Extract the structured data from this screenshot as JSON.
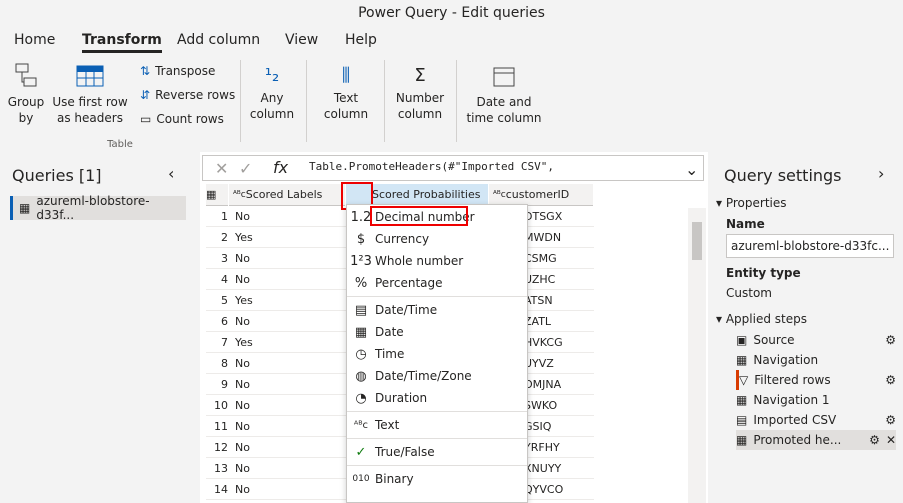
{
  "window": {
    "title": "Power Query - Edit queries"
  },
  "tabs": [
    "Home",
    "Transform",
    "Add column",
    "View",
    "Help"
  ],
  "ribbon": {
    "group_by": "Group by",
    "first_row": "Use first row as headers",
    "transpose": "Transpose",
    "reverse_rows": "Reverse rows",
    "count_rows": "Count rows",
    "table_group": "Table",
    "any_column": "Any column",
    "text_column": "Text column",
    "number_column": "Number column",
    "date_time_column": "Date and time column"
  },
  "queries": {
    "title": "Queries [1]",
    "item": "azureml-blobstore-d33f..."
  },
  "formula": {
    "fx": "fx",
    "text": "Table.PromoteHeaders(#\"Imported CSV\","
  },
  "columns": [
    "Scored Labels",
    "Scored Probabilities",
    "customerID"
  ],
  "rows": [
    {
      "n": "1",
      "label": "No",
      "id": "DTSGX"
    },
    {
      "n": "2",
      "label": "Yes",
      "id": "MWDN"
    },
    {
      "n": "3",
      "label": "No",
      "id": "CSMG"
    },
    {
      "n": "4",
      "label": "No",
      "id": "UZHC"
    },
    {
      "n": "5",
      "label": "Yes",
      "id": "ATSN"
    },
    {
      "n": "6",
      "label": "No",
      "id": "ZATL"
    },
    {
      "n": "7",
      "label": "Yes",
      "id": "HVKCG"
    },
    {
      "n": "8",
      "label": "No",
      "id": "UYVZ"
    },
    {
      "n": "9",
      "label": "No",
      "id": "OMJNA"
    },
    {
      "n": "10",
      "label": "No",
      "id": "SWKO"
    },
    {
      "n": "11",
      "label": "No",
      "id": "GSIQ"
    },
    {
      "n": "12",
      "label": "No",
      "id": "YRFHY"
    },
    {
      "n": "13",
      "label": "No",
      "id": "XNUYY"
    },
    {
      "n": "14",
      "label": "No",
      "id": "QYVCO"
    }
  ],
  "type_menu": [
    "Decimal number",
    "Currency",
    "Whole number",
    "Percentage",
    "Date/Time",
    "Date",
    "Time",
    "Date/Time/Zone",
    "Duration",
    "Text",
    "True/False",
    "Binary"
  ],
  "settings": {
    "title": "Query settings",
    "properties": "Properties",
    "name_label": "Name",
    "name_value": "azureml-blobstore-d33fc...",
    "entity_label": "Entity type",
    "entity_value": "Custom",
    "applied_steps": "Applied steps",
    "steps": [
      "Source",
      "Navigation",
      "Filtered rows",
      "Navigation 1",
      "Imported CSV",
      "Promoted he..."
    ]
  }
}
